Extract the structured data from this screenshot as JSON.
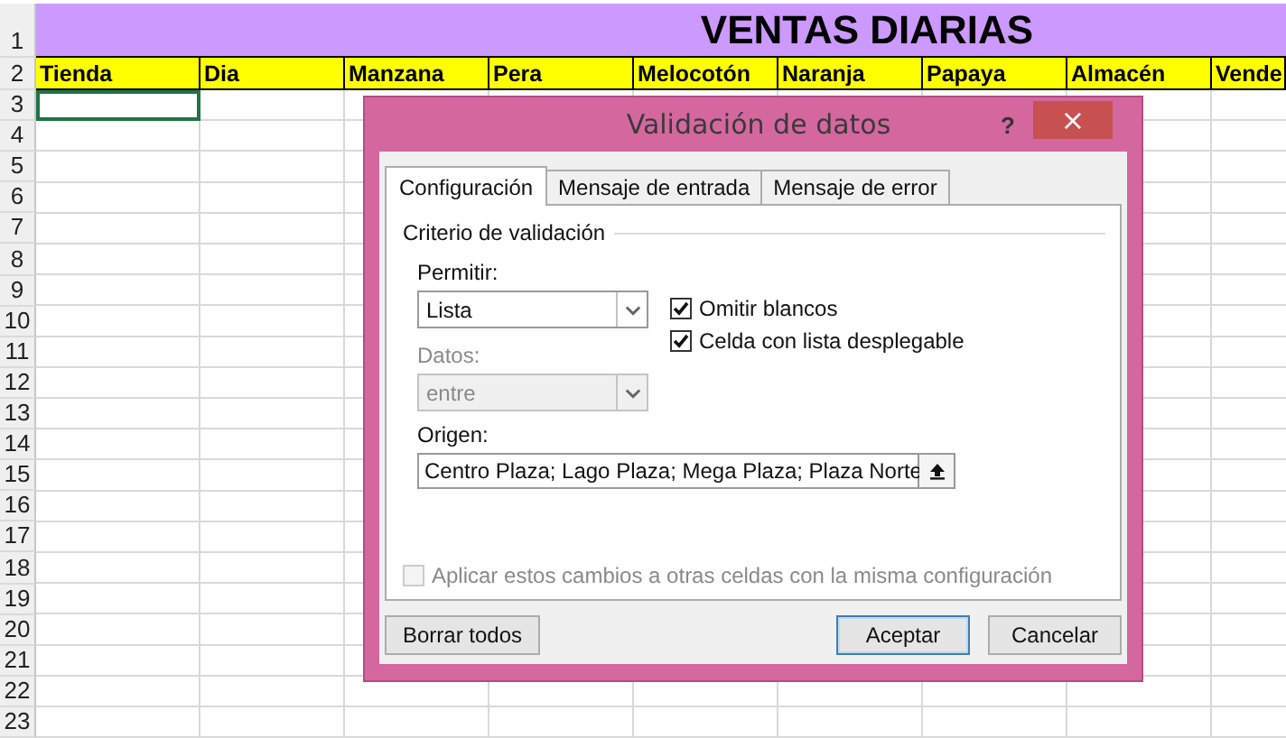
{
  "sheet": {
    "title": "VENTAS DIARIAS",
    "title_row": "1",
    "header_row": "2",
    "headers": [
      "Tienda",
      "Dia",
      "Manzana",
      "Pera",
      "Melocotón",
      "Naranja",
      "Papaya",
      "Almacén",
      "Vende"
    ],
    "rows": [
      {
        "number": "3",
        "selected": true
      },
      {
        "number": "4",
        "selected": false
      },
      {
        "number": "5",
        "selected": false
      },
      {
        "number": "6",
        "selected": false
      },
      {
        "number": "7",
        "selected": false
      },
      {
        "number": "8",
        "selected": false
      },
      {
        "number": "9",
        "selected": false
      },
      {
        "number": "10",
        "selected": false
      },
      {
        "number": "11",
        "selected": false
      },
      {
        "number": "12",
        "selected": false
      },
      {
        "number": "13",
        "selected": false
      },
      {
        "number": "14",
        "selected": false
      },
      {
        "number": "15",
        "selected": false
      },
      {
        "number": "16",
        "selected": false
      },
      {
        "number": "17",
        "selected": false
      },
      {
        "number": "18",
        "selected": false
      },
      {
        "number": "19",
        "selected": false
      },
      {
        "number": "20",
        "selected": false
      },
      {
        "number": "21",
        "selected": false
      },
      {
        "number": "22",
        "selected": false
      },
      {
        "number": "23",
        "selected": false
      }
    ]
  },
  "dialog": {
    "title": "Validación de datos",
    "help": "?",
    "close": "×",
    "tabs": [
      {
        "label": "Configuración",
        "selected": true
      },
      {
        "label": "Mensaje de entrada",
        "selected": false
      },
      {
        "label": "Mensaje de error",
        "selected": false
      }
    ],
    "section": "Criterio de validación",
    "allow": {
      "label": "Permitir:",
      "value": "Lista",
      "disabled": false
    },
    "data": {
      "label": "Datos:",
      "value": "entre",
      "disabled": true
    },
    "checkboxes": [
      {
        "label": "Omitir blancos",
        "checked": true,
        "disabled": false
      },
      {
        "label": "Celda con lista desplegable",
        "checked": true,
        "disabled": false
      }
    ],
    "source": {
      "label": "Origen:",
      "value": "Centro Plaza; Lago Plaza; Mega Plaza; Plaza Norte"
    },
    "apply_all": {
      "label": "Aplicar estos cambios a otras celdas con la misma configuración",
      "checked": false,
      "disabled": true
    },
    "buttons": [
      {
        "label": "Borrar todos",
        "default": false
      },
      {
        "label": "Aceptar",
        "default": true
      },
      {
        "label": "Cancelar",
        "default": false
      }
    ]
  }
}
